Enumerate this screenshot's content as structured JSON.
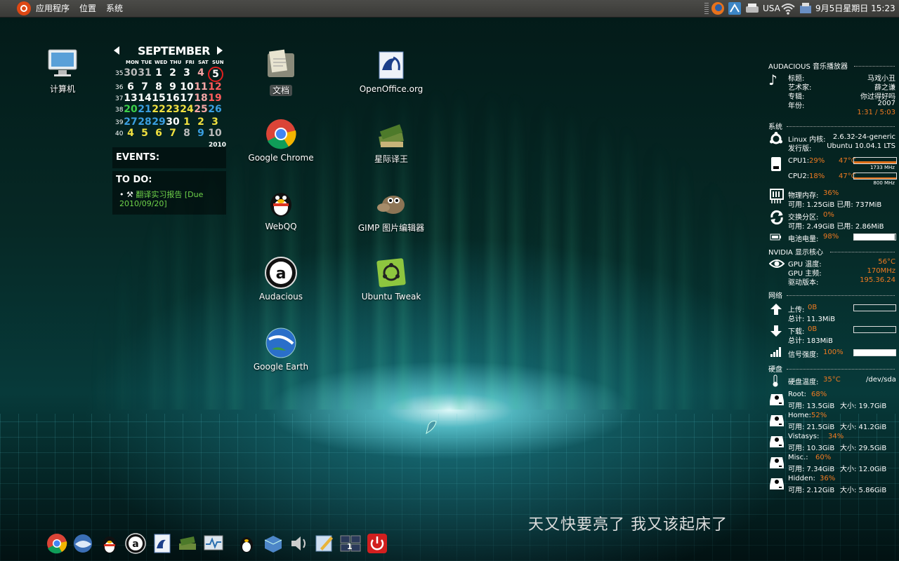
{
  "top_panel": {
    "menus": [
      "应用程序",
      "位置",
      "系统"
    ],
    "keyboard_layout": "USA",
    "datetime": "9月5日星期日 15:23"
  },
  "desktop_icons": {
    "computer": "计算机",
    "documents": "文档",
    "openoffice": "OpenOffice.org",
    "chrome": "Google Chrome",
    "translator": "星际译王",
    "webqq": "WebQQ",
    "gimp": "GIMP 图片编辑器",
    "audacious": "Audacious",
    "ubuntu_tweak": "Ubuntu Tweak",
    "google_earth": "Google Earth"
  },
  "calendar": {
    "month": "SEPTEMBER",
    "year": "2010",
    "weekdays": [
      "MON",
      "TUE",
      "WED",
      "THU",
      "FRI",
      "SAT",
      "SUN"
    ],
    "weeks": [
      {
        "num": "35",
        "days": [
          "30",
          "31",
          "1",
          "2",
          "3",
          "4",
          "5"
        ]
      },
      {
        "num": "36",
        "days": [
          "6",
          "7",
          "8",
          "9",
          "10",
          "11",
          "12"
        ]
      },
      {
        "num": "37",
        "days": [
          "13",
          "14",
          "15",
          "16",
          "17",
          "18",
          "19"
        ]
      },
      {
        "num": "38",
        "days": [
          "20",
          "21",
          "22",
          "23",
          "24",
          "25",
          "26"
        ]
      },
      {
        "num": "39",
        "days": [
          "27",
          "28",
          "29",
          "30",
          "1",
          "2",
          "3"
        ]
      },
      {
        "num": "40",
        "days": [
          "4",
          "5",
          "6",
          "7",
          "8",
          "9",
          "10"
        ]
      }
    ],
    "events_title": "EVENTS:",
    "todo_title": "TO DO:",
    "todo_item": "翻译实习报告 [Due 2010/09/20]"
  },
  "conky": {
    "audacious": {
      "header": "AUDACIOUS 音乐播放器",
      "title_label": "标题:",
      "title": "马戏小丑",
      "artist_label": "艺术家:",
      "artist": "薛之谦",
      "album_label": "专辑:",
      "album": "你过得好吗",
      "year_label": "年份:",
      "year": "2007",
      "time": "1:31 / 5:03"
    },
    "system": {
      "header": "系统",
      "kernel_label": "Linux 内核:",
      "kernel": "2.6.32-24-generic",
      "distro_label": "发行版:",
      "distro": "Ubuntu 10.04.1 LTS",
      "cpu1_label": "CPU1:",
      "cpu1": "29%",
      "cpu1_temp": "47°C",
      "cpu1_freq": "1733 MHz",
      "cpu2_label": "CPU2:",
      "cpu2": "18%",
      "cpu2_temp": "47°C",
      "cpu2_freq": "800 MHz",
      "mem_label": "物理内存:",
      "mem": "36%",
      "mem_detail": "可用: 1.25GiB   已用: 737MiB",
      "swap_label": "交换分区:",
      "swap": "0%",
      "swap_detail": "可用: 2.49GiB   已用: 2.86MiB",
      "battery_label": "电池电量:",
      "battery": "98%",
      "battery_level": 0.98
    },
    "nvidia": {
      "header": "NVIDIA 显示核心",
      "gpu_temp_label": "GPU 温度:",
      "gpu_temp": "56°C",
      "gpu_freq_label": "GPU 主频:",
      "gpu_freq": "170MHz",
      "driver_label": "驱动版本:",
      "driver": "195.36.24"
    },
    "network": {
      "header": "网络",
      "up_label": "上传:",
      "up": "0B",
      "up_total": "总计: 11.3MiB",
      "down_label": "下载:",
      "down": "0B",
      "down_total": "总计: 183MiB",
      "signal_label": "信号强度:",
      "signal": "100%",
      "signal_level": 1.0
    },
    "disk": {
      "header": "硬盘",
      "temp_label": "硬盘温度:",
      "temp": "35°C",
      "device": "/dev/sda",
      "partitions": [
        {
          "name": "Root:",
          "pct": "68%",
          "free": "可用: 13.5GiB",
          "size": "大小: 19.7GiB"
        },
        {
          "name": "Home:",
          "pct": "52%",
          "free": "可用: 21.5GiB",
          "size": "大小: 41.2GiB"
        },
        {
          "name": "Vistasys:",
          "pct": "34%",
          "free": "可用: 10.3GiB",
          "size": "大小: 29.5GiB"
        },
        {
          "name": "Misc.:",
          "pct": "60%",
          "free": "可用: 7.34GiB",
          "size": "大小: 12.0GiB"
        },
        {
          "name": "Hidden:",
          "pct": "36%",
          "free": "可用: 2.12GiB",
          "size": "大小: 5.86GiB"
        }
      ]
    }
  },
  "quote": "天又快要亮了 我又该起床了",
  "dock_workspace": "1",
  "colors": {
    "accent": "#f07a20",
    "ubuntu": "#dd4814"
  }
}
